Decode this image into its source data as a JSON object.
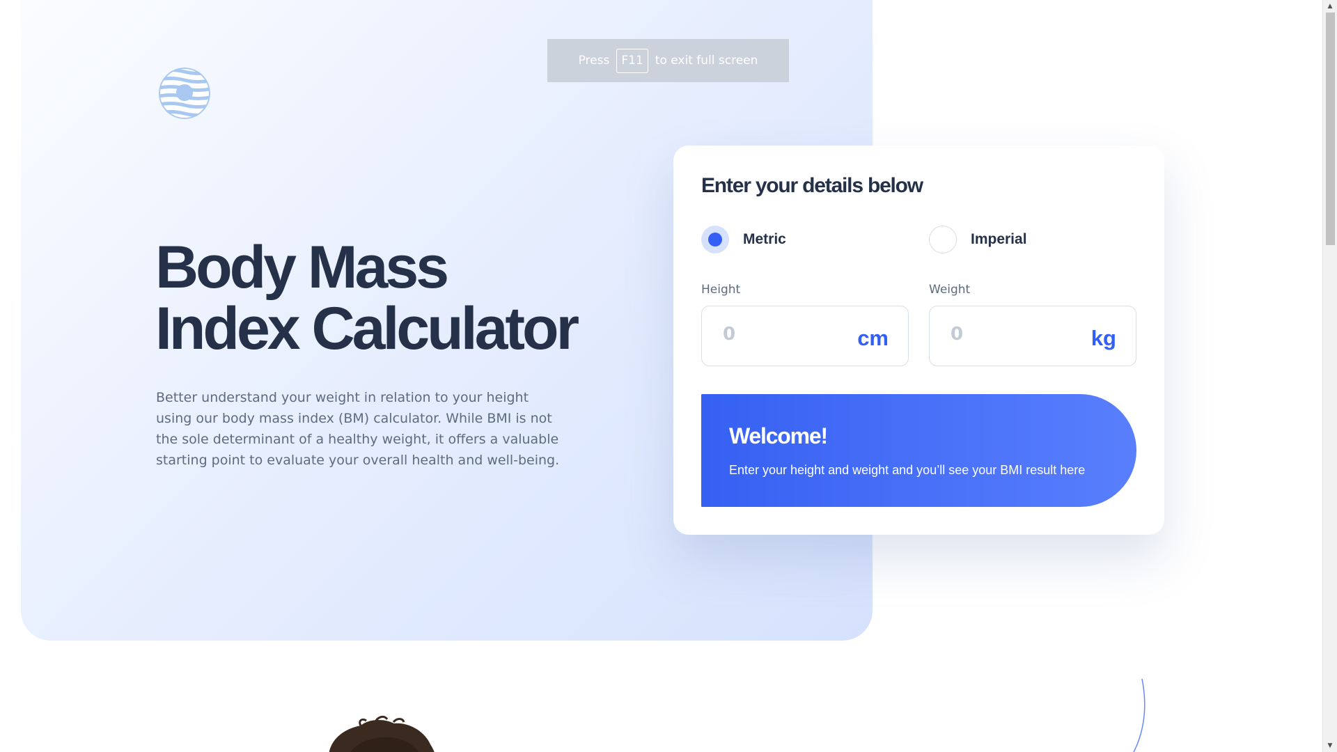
{
  "fullscreen_notice": {
    "prefix": "Press",
    "key": "F11",
    "suffix": "to exit full screen"
  },
  "logo": {
    "icon": "striped-circle-logo-icon",
    "colors": {
      "stripes": "#a9c8f1",
      "center": "#a9c8f1",
      "background": "#ffffff"
    }
  },
  "hero": {
    "title_line1": "Body Mass",
    "title_line2": "Index Calculator",
    "description": "Better understand your weight in relation to your height using our body mass index (BM) calculator. While BMI is not the sole determinant of a healthy weight, it offers a valuable starting point to evaluate your overall health and well-being."
  },
  "calculator": {
    "heading": "Enter your details below",
    "units": [
      {
        "label": "Metric",
        "selected": true
      },
      {
        "label": "Imperial",
        "selected": false
      }
    ],
    "height": {
      "label": "Height",
      "value": "0",
      "unit": "cm"
    },
    "weight": {
      "label": "Weight",
      "value": "0",
      "unit": "kg"
    },
    "result": {
      "title": "Welcome!",
      "text": "Enter your height and weight and you’ll see your BMI result here"
    }
  },
  "colors": {
    "accent": "#345ff6",
    "heading": "#243148",
    "body_text": "#5d6b80",
    "placeholder": "#c2cad6",
    "hero_gradient_end": "#d6e2fd"
  },
  "scrollbar": {
    "position_fraction": 0
  }
}
